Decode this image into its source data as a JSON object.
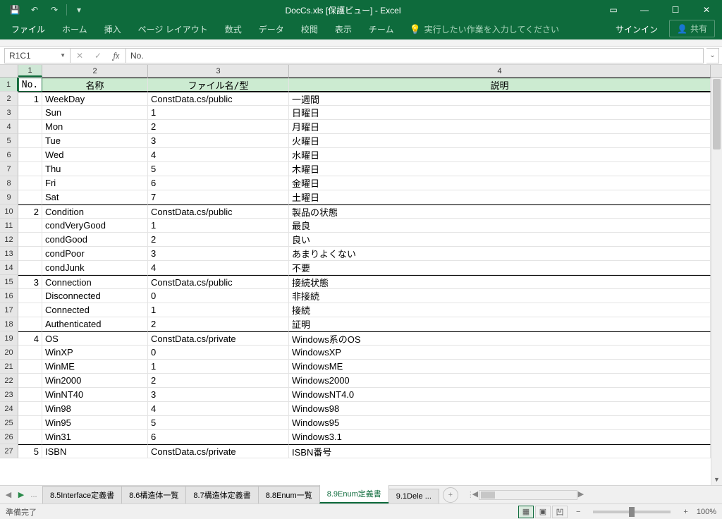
{
  "title": "DocCs.xls  [保護ビュー] - Excel",
  "qat": {
    "save": "💾",
    "undo": "↶",
    "redo": "↷",
    "more": "▾"
  },
  "win": {
    "ribbon_opts": "▭",
    "min": "—",
    "max": "☐",
    "close": "✕"
  },
  "ribbon": {
    "tabs": [
      "ファイル",
      "ホーム",
      "挿入",
      "ページ レイアウト",
      "数式",
      "データ",
      "校閲",
      "表示",
      "チーム"
    ],
    "tell_me": "実行したい作業を入力してください",
    "signin": "サインイン",
    "share": "共有"
  },
  "fx": {
    "name_box": "R1C1",
    "cancel": "✕",
    "enter": "✓",
    "label": "fx",
    "value": "No."
  },
  "cols": [
    "1",
    "2",
    "3",
    "4"
  ],
  "col_widths": {
    "c1": 34,
    "c2": 150,
    "c3": 200,
    "c4": 598
  },
  "header_row": {
    "c1": "No.",
    "c2": "名称",
    "c3": "ファイル名/型",
    "c4": "説明"
  },
  "rows": [
    {
      "r": 2,
      "group": true,
      "c1": "1",
      "c2": "WeekDay",
      "c3": "ConstData.cs/public",
      "c4": "一週間"
    },
    {
      "r": 3,
      "group": false,
      "c1": "",
      "c2": "Sun",
      "c3": "1",
      "c4": "日曜日"
    },
    {
      "r": 4,
      "group": false,
      "c1": "",
      "c2": "Mon",
      "c3": "2",
      "c4": "月曜日"
    },
    {
      "r": 5,
      "group": false,
      "c1": "",
      "c2": "Tue",
      "c3": "3",
      "c4": "火曜日"
    },
    {
      "r": 6,
      "group": false,
      "c1": "",
      "c2": "Wed",
      "c3": "4",
      "c4": "水曜日"
    },
    {
      "r": 7,
      "group": false,
      "c1": "",
      "c2": "Thu",
      "c3": "5",
      "c4": "木曜日"
    },
    {
      "r": 8,
      "group": false,
      "c1": "",
      "c2": "Fri",
      "c3": "6",
      "c4": "金曜日"
    },
    {
      "r": 9,
      "group": false,
      "c1": "",
      "c2": "Sat",
      "c3": "7",
      "c4": "土曜日"
    },
    {
      "r": 10,
      "group": true,
      "c1": "2",
      "c2": "Condition",
      "c3": "ConstData.cs/public",
      "c4": "製品の状態"
    },
    {
      "r": 11,
      "group": false,
      "c1": "",
      "c2": "condVeryGood",
      "c3": "1",
      "c4": "最良"
    },
    {
      "r": 12,
      "group": false,
      "c1": "",
      "c2": "condGood",
      "c3": "2",
      "c4": "良い"
    },
    {
      "r": 13,
      "group": false,
      "c1": "",
      "c2": "condPoor",
      "c3": "3",
      "c4": "あまりよくない"
    },
    {
      "r": 14,
      "group": false,
      "c1": "",
      "c2": "condJunk",
      "c3": "4",
      "c4": "不要"
    },
    {
      "r": 15,
      "group": true,
      "c1": "3",
      "c2": "Connection",
      "c3": "ConstData.cs/public",
      "c4": "接続状態"
    },
    {
      "r": 16,
      "group": false,
      "c1": "",
      "c2": "Disconnected",
      "c3": "0",
      "c4": "非接続"
    },
    {
      "r": 17,
      "group": false,
      "c1": "",
      "c2": "Connected",
      "c3": "1",
      "c4": "接続"
    },
    {
      "r": 18,
      "group": false,
      "c1": "",
      "c2": "Authenticated",
      "c3": "2",
      "c4": "証明"
    },
    {
      "r": 19,
      "group": true,
      "c1": "4",
      "c2": "OS",
      "c3": "ConstData.cs/private",
      "c4": "Windows系のOS"
    },
    {
      "r": 20,
      "group": false,
      "c1": "",
      "c2": "WinXP",
      "c3": "0",
      "c4": "WindowsXP"
    },
    {
      "r": 21,
      "group": false,
      "c1": "",
      "c2": "WinME",
      "c3": "1",
      "c4": "WindowsME"
    },
    {
      "r": 22,
      "group": false,
      "c1": "",
      "c2": "Win2000",
      "c3": "2",
      "c4": "Windows2000"
    },
    {
      "r": 23,
      "group": false,
      "c1": "",
      "c2": "WinNT40",
      "c3": "3",
      "c4": "WindowsNT4.0"
    },
    {
      "r": 24,
      "group": false,
      "c1": "",
      "c2": "Win98",
      "c3": "4",
      "c4": "Windows98"
    },
    {
      "r": 25,
      "group": false,
      "c1": "",
      "c2": "Win95",
      "c3": "5",
      "c4": "Windows95"
    },
    {
      "r": 26,
      "group": false,
      "c1": "",
      "c2": "Win31",
      "c3": "6",
      "c4": "Windows3.1"
    },
    {
      "r": 27,
      "group": true,
      "c1": "5",
      "c2": "ISBN",
      "c3": "ConstData.cs/private",
      "c4": "ISBN番号"
    }
  ],
  "sheet_tabs": {
    "overflow": "...",
    "items": [
      "8.5Interface定義書",
      "8.6構造体一覧",
      "8.7構造体定義書",
      "8.8Enum一覧",
      "8.9Enum定義書",
      "9.1Dele ..."
    ],
    "active_index": 4,
    "add": "+"
  },
  "status": {
    "ready": "準備完了",
    "zoom": "100%",
    "minus": "−",
    "plus": "+"
  }
}
